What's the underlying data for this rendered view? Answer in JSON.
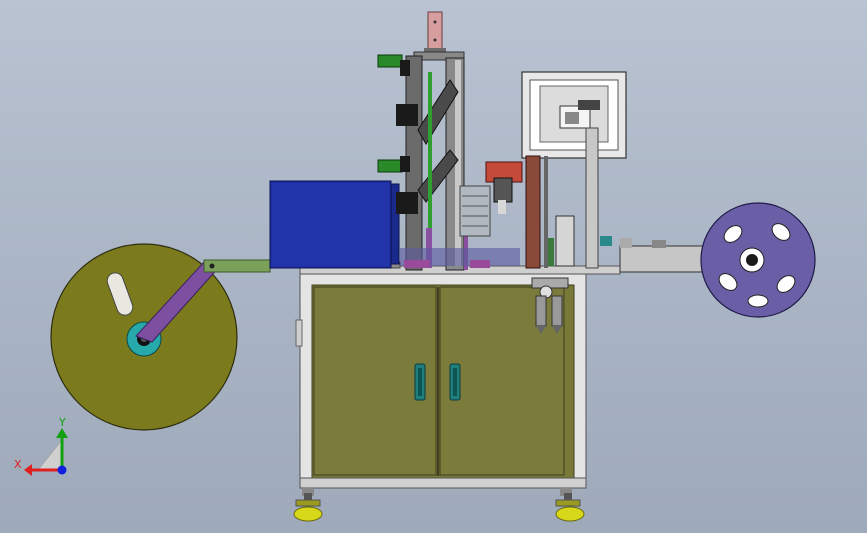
{
  "view": {
    "triad": {
      "x_label": "X",
      "y_label": "Y"
    }
  },
  "colors": {
    "background": "#a9b4c4",
    "reel_left": "#7b7a1c",
    "reel_right": "#6a5fa6",
    "cabinet": "#7a7a38",
    "frame": "#d8d8d8",
    "hopper": "#1d2fa3",
    "handle": "#1f7f7d",
    "foot": "#d8d81a",
    "arm": "#7c4fa0",
    "axis_x": "#e02020",
    "axis_y": "#10a010",
    "axis_z": "#1020e0"
  },
  "icons": {
    "triad": "coordinate-axes-icon"
  }
}
